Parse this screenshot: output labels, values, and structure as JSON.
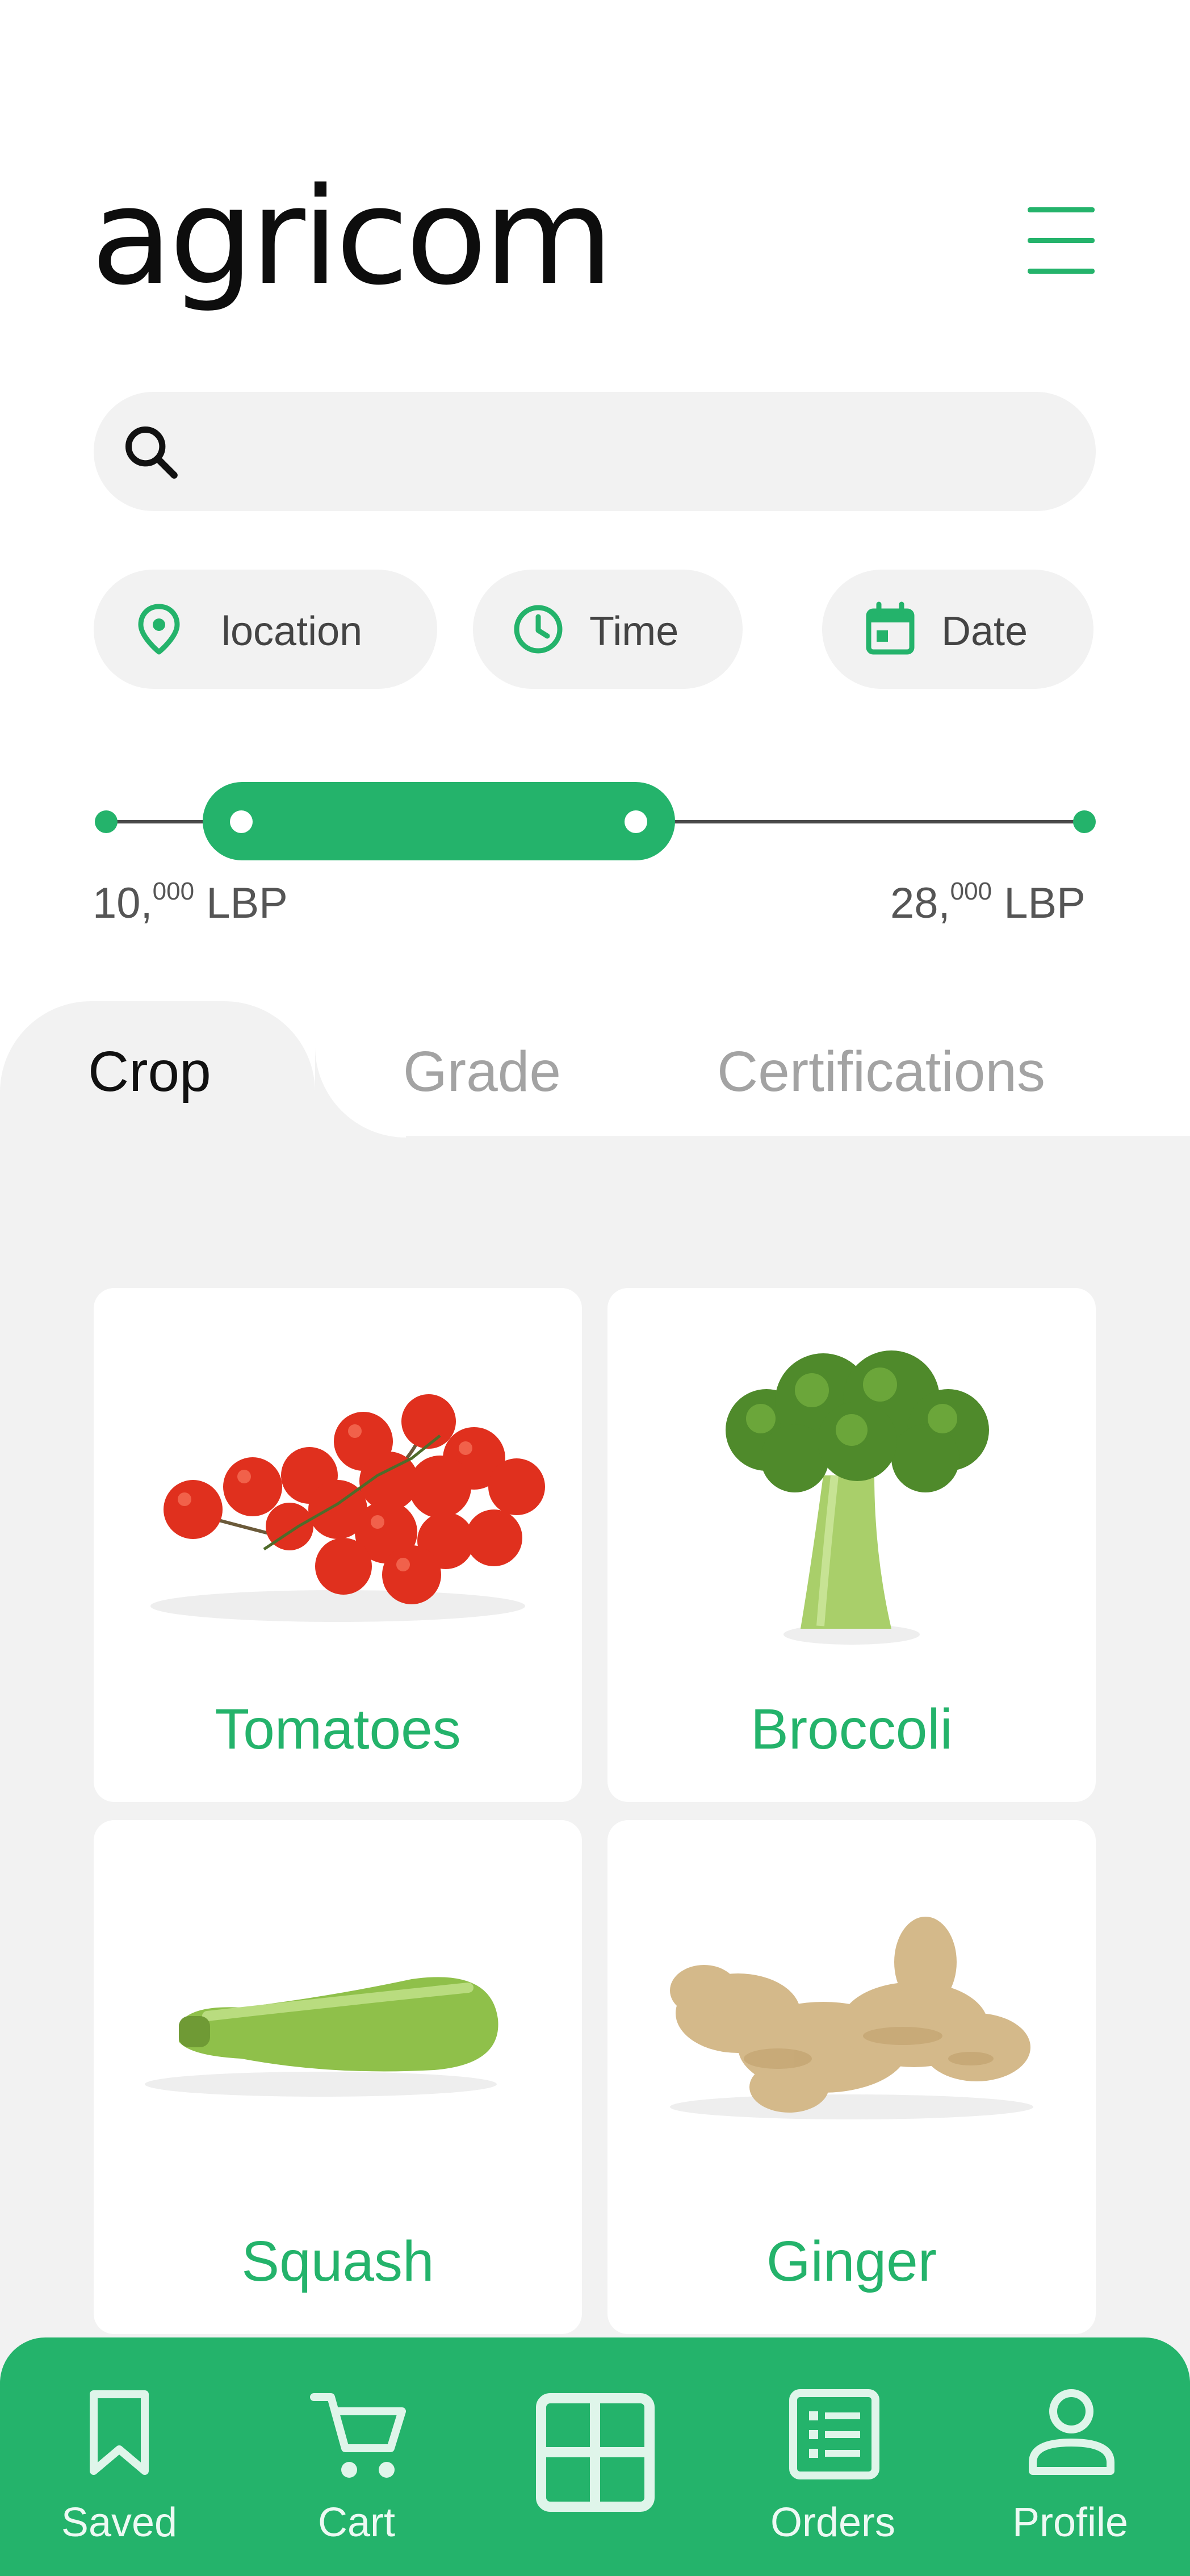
{
  "app": {
    "logo": "agricom"
  },
  "search": {
    "placeholder": ""
  },
  "filters": {
    "location": "location",
    "time": "Time",
    "date": "Date"
  },
  "price_range": {
    "min_label": "10,",
    "min_sup": "000",
    "currency": " LBP",
    "max_label": "28,",
    "max_sup": "000",
    "selected_start_fraction": 0.14,
    "selected_end_fraction": 0.55
  },
  "tabs": [
    {
      "label": "Crop",
      "active": true
    },
    {
      "label": "Grade",
      "active": false
    },
    {
      "label": "Certifications",
      "active": false
    }
  ],
  "products": [
    {
      "name": "Tomatoes",
      "image": "tomatoes-image"
    },
    {
      "name": "Broccoli",
      "image": "broccoli-image"
    },
    {
      "name": "Squash",
      "image": "squash-image"
    },
    {
      "name": "Ginger",
      "image": "ginger-image"
    }
  ],
  "bottom_nav": [
    {
      "label": "Saved",
      "icon": "bookmark-icon"
    },
    {
      "label": "Cart",
      "icon": "cart-icon"
    },
    {
      "label": "",
      "icon": "grid-icon"
    },
    {
      "label": "Orders",
      "icon": "list-icon"
    },
    {
      "label": "Profile",
      "icon": "user-icon"
    }
  ],
  "colors": {
    "accent": "#24b36b",
    "panel": "#f2f2f2",
    "inactive_text": "#a3a3a3"
  }
}
